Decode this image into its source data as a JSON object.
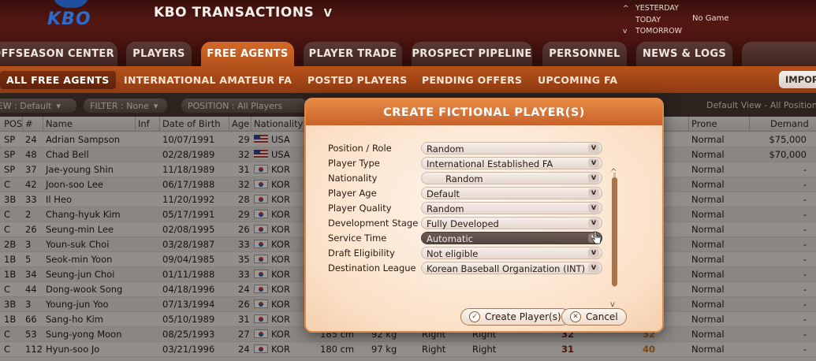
{
  "header": {
    "logo": "KBO",
    "title": "KBO TRANSACTIONS",
    "title_arrow": "V",
    "date_nav": [
      {
        "arrow": "^",
        "label": "YESTERDAY"
      },
      {
        "arrow": "",
        "label": "TODAY"
      },
      {
        "arrow": "v",
        "label": "TOMORROW"
      }
    ],
    "today_status": "No Game"
  },
  "main_tabs": [
    {
      "label": "OFFSEASON CENTER",
      "active": false
    },
    {
      "label": "PLAYERS",
      "active": false
    },
    {
      "label": "FREE AGENTS",
      "active": true
    },
    {
      "label": "PLAYER TRADE",
      "active": false
    },
    {
      "label": "PROSPECT PIPELINE",
      "active": false
    },
    {
      "label": "PERSONNEL",
      "active": false
    },
    {
      "label": "NEWS & LOGS",
      "active": false
    }
  ],
  "sub_tabs": [
    {
      "label": "ALL FREE AGENTS",
      "active": true
    },
    {
      "label": "INTERNATIONAL AMATEUR FA",
      "active": false
    },
    {
      "label": "POSTED PLAYERS",
      "active": false
    },
    {
      "label": "PENDING OFFERS",
      "active": false
    },
    {
      "label": "UPCOMING FA",
      "active": false
    }
  ],
  "import_button": "IMPORT",
  "filters": {
    "view": "VIEW : Default",
    "filter": "FILTER : None",
    "position": "POSITION : All Players",
    "default_view_label": "Default View - All Positions"
  },
  "table": {
    "headers": [
      "POS",
      "#",
      "Name",
      "Inf",
      "Date of Birth",
      "Age",
      "Nationality",
      "Prone",
      "Demand"
    ],
    "rows": [
      {
        "pos": "SP",
        "num": "24",
        "name": "Adrian Sampson",
        "dob": "10/07/1991",
        "age": "29",
        "nat": "USA",
        "flag": "usa",
        "prone": "Normal",
        "demand": "$75,000"
      },
      {
        "pos": "SP",
        "num": "48",
        "name": "Chad Bell",
        "dob": "02/28/1989",
        "age": "32",
        "nat": "USA",
        "flag": "usa",
        "prone": "Normal",
        "demand": "$70,000"
      },
      {
        "pos": "SP",
        "num": "37",
        "name": "Jae-young Shin",
        "dob": "11/18/1989",
        "age": "31",
        "nat": "KOR",
        "flag": "kor",
        "prone": "Normal",
        "demand": "-"
      },
      {
        "pos": "C",
        "num": "42",
        "name": "Joon-soo Lee",
        "dob": "06/17/1988",
        "age": "32",
        "nat": "KOR",
        "flag": "kor",
        "prone": "Normal",
        "demand": "-"
      },
      {
        "pos": "3B",
        "num": "33",
        "name": "Il Heo",
        "dob": "11/20/1992",
        "age": "28",
        "nat": "KOR",
        "flag": "kor",
        "prone": "Normal",
        "demand": "-"
      },
      {
        "pos": "C",
        "num": "2",
        "name": "Chang-hyuk Kim",
        "dob": "05/17/1991",
        "age": "29",
        "nat": "KOR",
        "flag": "kor",
        "prone": "Normal",
        "demand": "-"
      },
      {
        "pos": "C",
        "num": "26",
        "name": "Seung-min Lee",
        "dob": "02/08/1995",
        "age": "26",
        "nat": "KOR",
        "flag": "kor",
        "prone": "Normal",
        "demand": "-"
      },
      {
        "pos": "2B",
        "num": "3",
        "name": "Youn-suk Choi",
        "dob": "03/28/1987",
        "age": "33",
        "nat": "KOR",
        "flag": "kor",
        "prone": "Normal",
        "demand": "-"
      },
      {
        "pos": "1B",
        "num": "5",
        "name": "Seok-min Yoon",
        "dob": "09/04/1985",
        "age": "35",
        "nat": "KOR",
        "flag": "kor",
        "prone": "Normal",
        "demand": "-"
      },
      {
        "pos": "1B",
        "num": "34",
        "name": "Seung-jun Choi",
        "dob": "01/11/1988",
        "age": "33",
        "nat": "KOR",
        "flag": "kor",
        "prone": "Normal",
        "demand": "-"
      },
      {
        "pos": "C",
        "num": "44",
        "name": "Dong-wook Song",
        "dob": "04/18/1996",
        "age": "24",
        "nat": "KOR",
        "flag": "kor",
        "prone": "Normal",
        "demand": "-"
      },
      {
        "pos": "3B",
        "num": "3",
        "name": "Young-jun Yoo",
        "dob": "07/13/1994",
        "age": "26",
        "nat": "KOR",
        "flag": "kor",
        "prone": "Normal",
        "demand": "-"
      },
      {
        "pos": "1B",
        "num": "66",
        "name": "Sang-ho Kim",
        "dob": "05/10/1989",
        "age": "31",
        "nat": "KOR",
        "flag": "kor",
        "prone": "Normal",
        "demand": "-"
      },
      {
        "pos": "C",
        "num": "53",
        "name": "Sung-yong Moon",
        "dob": "08/25/1993",
        "age": "27",
        "nat": "KOR",
        "flag": "kor",
        "prone": "Normal",
        "demand": "-",
        "height": "185 cm",
        "weight": "92 kg",
        "bats": "Right",
        "throws": "Right",
        "r1": "32",
        "r2": "32"
      },
      {
        "pos": "C",
        "num": "112",
        "name": "Hyun-soo Jo",
        "dob": "03/21/1996",
        "age": "24",
        "nat": "KOR",
        "flag": "kor",
        "prone": "Normal",
        "demand": "-",
        "height": "180 cm",
        "weight": "97 kg",
        "bats": "Right",
        "throws": "Right",
        "r1": "31",
        "r2": "40"
      }
    ]
  },
  "dialog": {
    "title": "CREATE FICTIONAL PLAYER(S)",
    "fields": [
      {
        "label": "Position / Role",
        "value": "Random",
        "selected": false
      },
      {
        "label": "Player Type",
        "value": "International Established FA",
        "selected": false
      },
      {
        "label": "Nationality",
        "value": "Random",
        "selected": false,
        "indent": true
      },
      {
        "label": "Player Age",
        "value": "Default",
        "selected": false
      },
      {
        "label": "Player Quality",
        "value": "Random",
        "selected": false
      },
      {
        "label": "Development Stage",
        "value": "Fully Developed",
        "selected": false
      },
      {
        "label": "Service Time",
        "value": "Automatic",
        "selected": true
      },
      {
        "label": "Draft Eligibility",
        "value": "Not eligible",
        "selected": false
      },
      {
        "label": "Destination League",
        "value": "Korean Baseball Organization (INT)",
        "selected": false
      }
    ],
    "create_button": "Create Player(s)",
    "cancel_button": "Cancel"
  },
  "colors": {
    "accent": "#c8622a",
    "active_tab": "#d36a2a",
    "header_bg": "#541813",
    "dialog_bg": "#fbe3cc"
  }
}
